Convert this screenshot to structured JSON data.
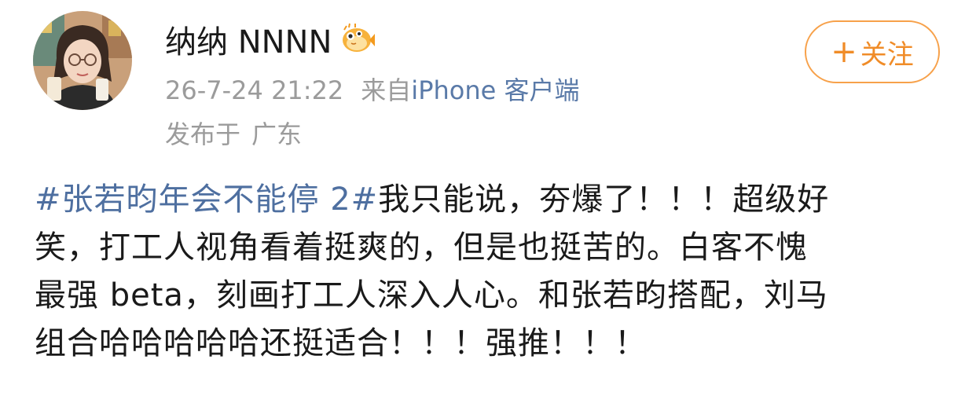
{
  "user": {
    "name": "纳纳 NNNN",
    "badge_icon": "pufferfish-badge-icon"
  },
  "meta": {
    "timestamp": "26-7-24 21:22",
    "source_prefix": "来自",
    "source_device": "iPhone 客户端",
    "location_prefix": "发布于",
    "location": "广东"
  },
  "follow_button": {
    "plus": "+",
    "label": "关注"
  },
  "post": {
    "hashtag": "#张若昀年会不能停 2#",
    "lines": [
      "我只能说，夯爆了！！！超级好",
      "笑，打工人视角看着挺爽的，但是也挺苦的。白客不愧",
      "最强 beta，刻画打工人深入人心。和张若昀搭配，刘马",
      "组合哈哈哈哈哈还挺适合！！！强推！！！"
    ]
  },
  "colors": {
    "accent_orange": "#f08c28",
    "link_blue": "#4e6fa0",
    "meta_gray": "#9b9b9b"
  }
}
